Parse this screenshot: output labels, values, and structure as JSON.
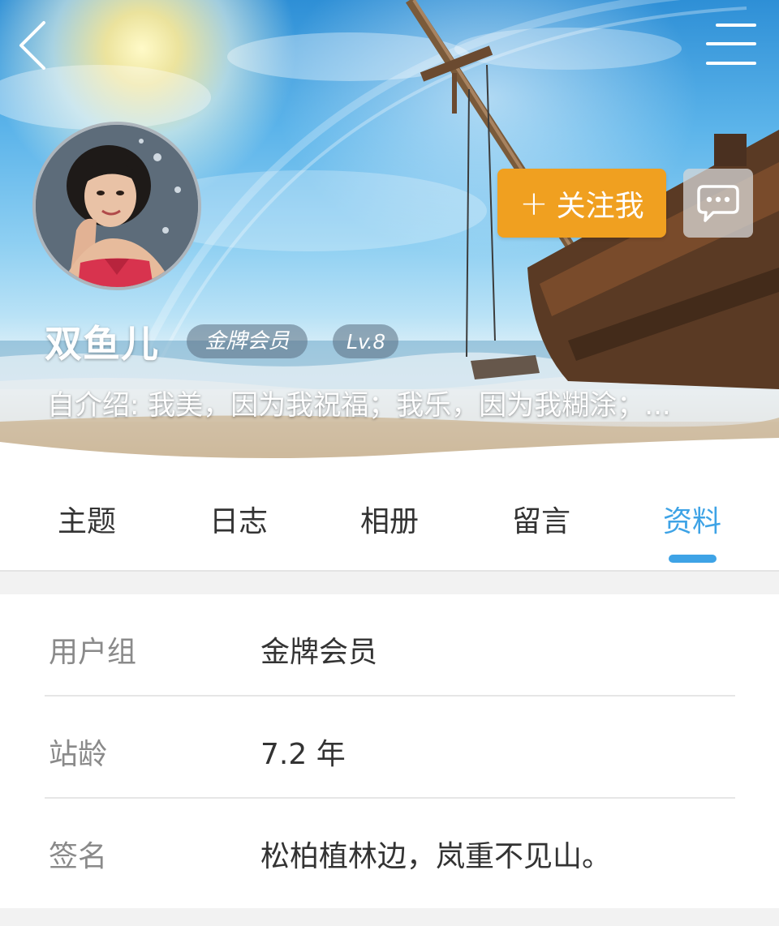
{
  "header": {
    "username": "双鱼儿",
    "rank_badge": "金牌会员",
    "level_badge": "Lv.8",
    "bio_label": "自介绍:",
    "bio_text": "我美，因为我祝福；我乐，因为我糊涂；...",
    "follow_button": "关注我",
    "follow_icon": "plus-icon",
    "message_icon": "chat-bubble-icon",
    "back_icon": "back-arrow-icon",
    "menu_icon": "hamburger-menu-icon"
  },
  "tabs": [
    {
      "label": "主题"
    },
    {
      "label": "日志"
    },
    {
      "label": "相册"
    },
    {
      "label": "留言"
    },
    {
      "label": "资料",
      "active": true
    }
  ],
  "profile": {
    "rows": [
      {
        "label": "用户组",
        "value": "金牌会员"
      },
      {
        "label": "站龄",
        "value": "7.2 年"
      },
      {
        "label": "签名",
        "value": "松柏植林边，岚重不见山。"
      }
    ]
  },
  "colors": {
    "accent_blue": "#3ea3e6",
    "follow_orange": "#f0a020"
  }
}
